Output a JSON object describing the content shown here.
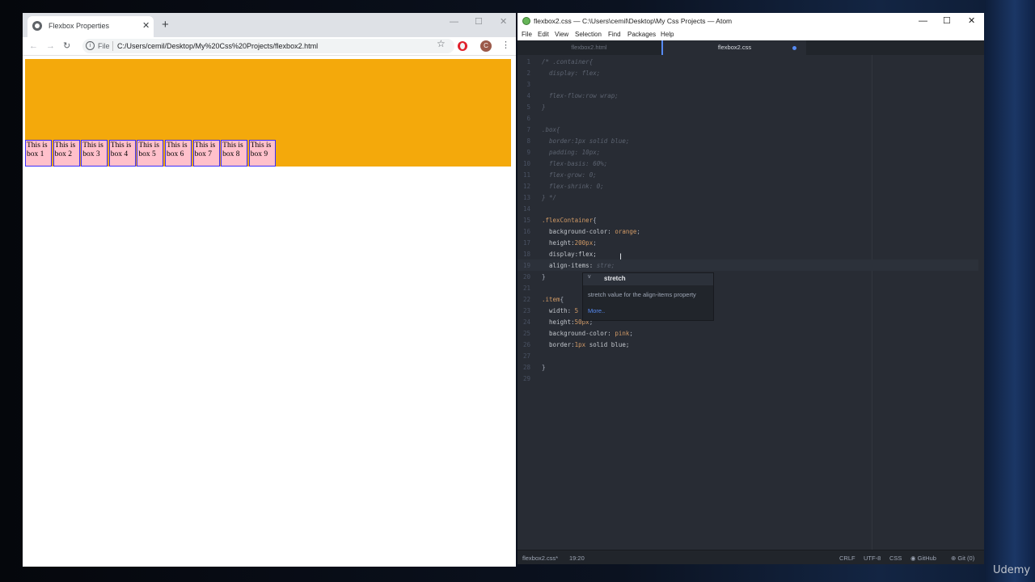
{
  "browser": {
    "tab_title": "Flexbox Properties",
    "tab_close": "✕",
    "new_tab": "+",
    "file_label": "File",
    "url": "C:/Users/cemil/Desktop/My%20Css%20Projects/flexbox2.html",
    "avatar_letter": "C",
    "page": {
      "container_color": "#f4a90b",
      "item_color": "#ffc0cb",
      "boxes": [
        {
          "line1": "This is",
          "line2": "box 1"
        },
        {
          "line1": "This is",
          "line2": "box 2"
        },
        {
          "line1": "This is",
          "line2": "box 3"
        },
        {
          "line1": "This is",
          "line2": "box 4"
        },
        {
          "line1": "This is",
          "line2": "box 5"
        },
        {
          "line1": "This is",
          "line2": "box 6"
        },
        {
          "line1": "This is",
          "line2": "box 7"
        },
        {
          "line1": "This is",
          "line2": "box 8"
        },
        {
          "line1": "This is",
          "line2": "box 9"
        }
      ]
    }
  },
  "atom": {
    "title": "flexbox2.css — C:\\Users\\cemil\\Desktop\\My Css Projects — Atom",
    "menu": [
      "File",
      "Edit",
      "View",
      "Selection",
      "Find",
      "Packages",
      "Help"
    ],
    "tabs": [
      {
        "label": "flexbox2.html"
      },
      {
        "label": "flexbox2.css"
      }
    ],
    "code_lines": [
      {
        "n": "1",
        "segments": [
          {
            "t": "/* .container{",
            "c": "c-comment"
          }
        ]
      },
      {
        "n": "2",
        "segments": [
          {
            "t": "  display: flex;",
            "c": "c-comment"
          }
        ]
      },
      {
        "n": "3",
        "segments": []
      },
      {
        "n": "4",
        "segments": [
          {
            "t": "  flex-flow:row wrap;",
            "c": "c-comment"
          }
        ]
      },
      {
        "n": "5",
        "segments": [
          {
            "t": "}",
            "c": "c-comment"
          }
        ]
      },
      {
        "n": "6",
        "segments": []
      },
      {
        "n": "7",
        "segments": [
          {
            "t": ".box{",
            "c": "c-comment"
          }
        ]
      },
      {
        "n": "8",
        "segments": [
          {
            "t": "  border:1px solid blue;",
            "c": "c-comment"
          }
        ]
      },
      {
        "n": "9",
        "segments": [
          {
            "t": "  padding: 10px;",
            "c": "c-comment"
          }
        ]
      },
      {
        "n": "10",
        "segments": [
          {
            "t": "  flex-basis: 60%;",
            "c": "c-comment"
          }
        ]
      },
      {
        "n": "11",
        "segments": [
          {
            "t": "  flex-grow: 0;",
            "c": "c-comment"
          }
        ]
      },
      {
        "n": "12",
        "segments": [
          {
            "t": "  flex-shrink: 0;",
            "c": "c-comment"
          }
        ]
      },
      {
        "n": "13",
        "segments": [
          {
            "t": "} */",
            "c": "c-comment"
          }
        ]
      },
      {
        "n": "14",
        "segments": []
      },
      {
        "n": "15",
        "segments": [
          {
            "t": ".flexContainer",
            "c": "c-sel"
          },
          {
            "t": "{",
            "c": "c-plain"
          }
        ]
      },
      {
        "n": "16",
        "segments": [
          {
            "t": "  background-color: ",
            "c": "c-prop"
          },
          {
            "t": "orange",
            "c": "c-val"
          },
          {
            "t": ";",
            "c": "c-plain"
          }
        ]
      },
      {
        "n": "17",
        "segments": [
          {
            "t": "  height:",
            "c": "c-prop"
          },
          {
            "t": "200px",
            "c": "c-num"
          },
          {
            "t": ";",
            "c": "c-plain"
          }
        ]
      },
      {
        "n": "18",
        "segments": [
          {
            "t": "  display:flex;",
            "c": "c-prop"
          }
        ]
      },
      {
        "n": "19",
        "segments": [
          {
            "t": "  align-items: ",
            "c": "c-prop"
          },
          {
            "t": "stre;",
            "c": "c-comment"
          }
        ]
      },
      {
        "n": "20",
        "segments": [
          {
            "t": "}",
            "c": "c-plain"
          }
        ]
      },
      {
        "n": "21",
        "segments": []
      },
      {
        "n": "22",
        "segments": [
          {
            "t": ".item",
            "c": "c-sel"
          },
          {
            "t": "{",
            "c": "c-plain"
          }
        ]
      },
      {
        "n": "23",
        "segments": [
          {
            "t": "  width: ",
            "c": "c-prop"
          },
          {
            "t": "5",
            "c": "c-num"
          }
        ]
      },
      {
        "n": "24",
        "segments": [
          {
            "t": "  height:",
            "c": "c-prop"
          },
          {
            "t": "50px",
            "c": "c-num"
          },
          {
            "t": ";",
            "c": "c-plain"
          }
        ]
      },
      {
        "n": "25",
        "segments": [
          {
            "t": "  background-color: ",
            "c": "c-prop"
          },
          {
            "t": "pink",
            "c": "c-val"
          },
          {
            "t": ";",
            "c": "c-plain"
          }
        ]
      },
      {
        "n": "26",
        "segments": [
          {
            "t": "  border:",
            "c": "c-prop"
          },
          {
            "t": "1px",
            "c": "c-num"
          },
          {
            "t": " solid blue;",
            "c": "c-prop"
          }
        ]
      },
      {
        "n": "27",
        "segments": []
      },
      {
        "n": "28",
        "segments": [
          {
            "t": "}",
            "c": "c-plain"
          }
        ]
      },
      {
        "n": "29",
        "segments": []
      }
    ],
    "autocomplete": {
      "type_badge": "v",
      "suggestion": "stretch",
      "description": "stretch value for the align-items property",
      "more": "More.."
    },
    "status": {
      "file": "flexbox2.css*",
      "cursor": "19:20",
      "line_ending": "CRLF",
      "encoding": "UTF-8",
      "grammar": "CSS",
      "github": "GitHub",
      "git": "Git (0)"
    }
  },
  "watermark": "Udemy"
}
